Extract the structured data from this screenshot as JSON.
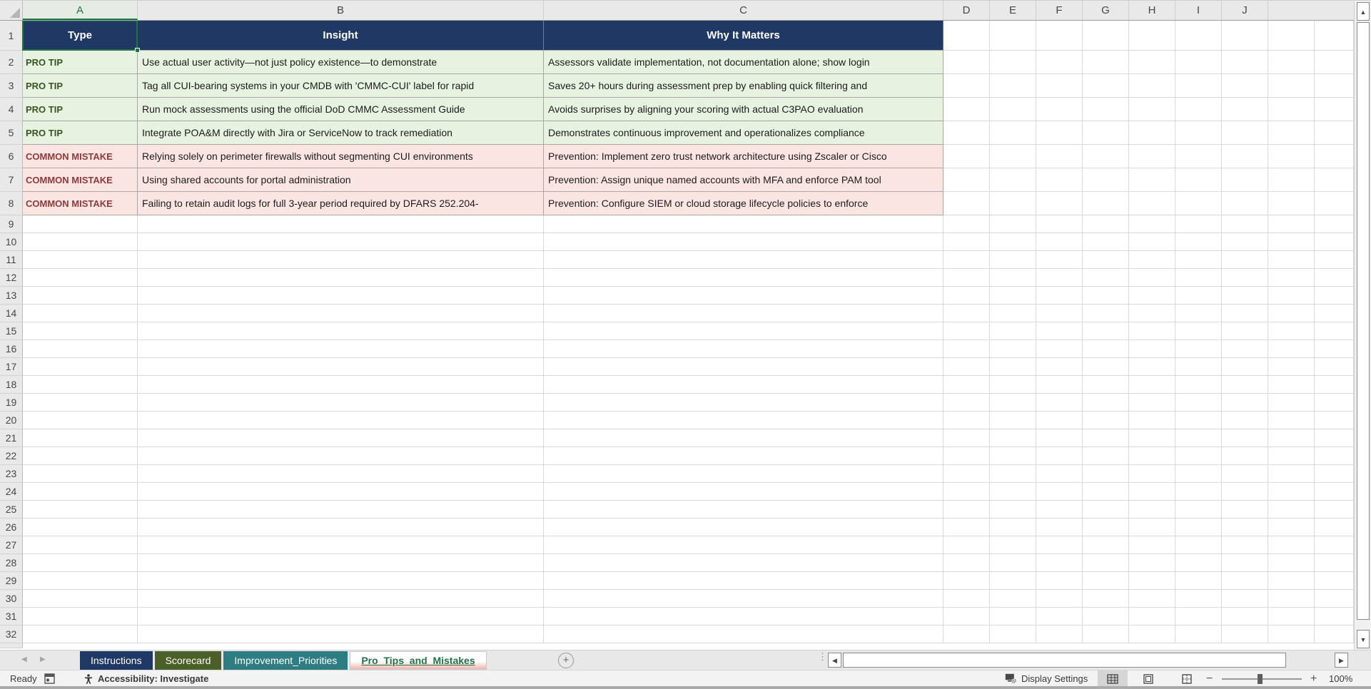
{
  "sheet": {
    "columns": [
      "A",
      "B",
      "C",
      "D",
      "E",
      "F",
      "G",
      "H",
      "I",
      "J"
    ],
    "selected_column": "A",
    "selected_cell": "A1",
    "visible_rows": 32,
    "header_row": {
      "row": 1,
      "cells": [
        "Type",
        "Insight",
        "Why It Matters"
      ]
    },
    "data_rows": [
      {
        "row": 2,
        "kind": "tip",
        "type": "PRO TIP",
        "insight": "Use actual user activity—not just policy existence—to demonstrate",
        "why": "Assessors validate implementation, not documentation alone; show login"
      },
      {
        "row": 3,
        "kind": "tip",
        "type": "PRO TIP",
        "insight": "Tag all CUI-bearing systems in your CMDB with 'CMMC-CUI' label for rapid",
        "why": "Saves 20+ hours during assessment prep by enabling quick filtering and"
      },
      {
        "row": 4,
        "kind": "tip",
        "type": "PRO TIP",
        "insight": "Run mock assessments using the official DoD CMMC Assessment Guide",
        "why": "Avoids surprises by aligning your scoring with actual C3PAO evaluation"
      },
      {
        "row": 5,
        "kind": "tip",
        "type": "PRO TIP",
        "insight": "Integrate POA&M directly with Jira or ServiceNow to track remediation",
        "why": "Demonstrates continuous improvement and operationalizes compliance"
      },
      {
        "row": 6,
        "kind": "mistake",
        "type": "COMMON MISTAKE",
        "insight": "Relying solely on perimeter firewalls without segmenting CUI environments",
        "why": "Prevention: Implement zero trust network architecture using Zscaler or Cisco"
      },
      {
        "row": 7,
        "kind": "mistake",
        "type": "COMMON MISTAKE",
        "insight": "Using shared accounts for portal administration",
        "why": "Prevention: Assign unique named accounts with MFA and enforce PAM tool"
      },
      {
        "row": 8,
        "kind": "mistake",
        "type": "COMMON MISTAKE",
        "insight": "Failing to retain audit logs for full 3-year period required by DFARS 252.204-",
        "why": "Prevention: Configure SIEM or cloud storage lifecycle policies to enforce"
      }
    ]
  },
  "colors": {
    "header_fill": "#1F3864",
    "header_text": "#FFFFFF",
    "tip_fill": "#E7F2E1",
    "tip_label": "#375623",
    "mistake_fill": "#FBE5E3",
    "mistake_label": "#8E3A3A",
    "selection_green": "#217346"
  },
  "sheet_tabs": [
    {
      "label": "Instructions",
      "color": "#1F3864",
      "active": false
    },
    {
      "label": "Scorecard",
      "color": "#4D5F28",
      "active": false
    },
    {
      "label": "Improvement_Priorities",
      "color": "#2E7D82",
      "active": false
    },
    {
      "label": "Pro_Tips_and_Mistakes",
      "color": "#F0B5AF",
      "active": true,
      "active_text_color": "#217346"
    }
  ],
  "icons": {
    "tab_nav_left": "◀",
    "tab_nav_right": "▶",
    "add_sheet": "+",
    "splitter_dots": "⋮",
    "hscroll_left": "◀",
    "hscroll_right": "▶",
    "vscroll_up": "▲",
    "vscroll_down": "▼"
  },
  "status_bar": {
    "ready": "Ready",
    "accessibility": "Accessibility: Investigate",
    "display_settings": "Display Settings",
    "zoom_out": "−",
    "zoom_in": "+",
    "zoom_level": "100%"
  }
}
